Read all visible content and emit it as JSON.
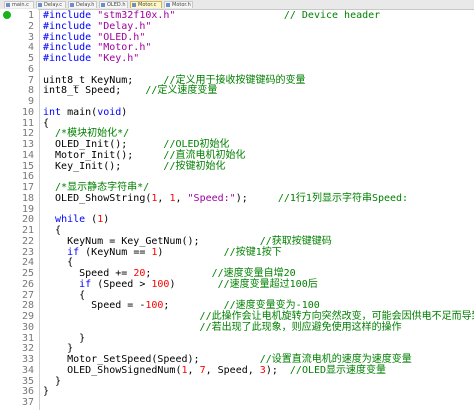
{
  "tabs": [
    {
      "label": "main.c",
      "active": false
    },
    {
      "label": "Delay.c",
      "active": false
    },
    {
      "label": "Delay.h",
      "active": false
    },
    {
      "label": "OLED.h",
      "active": false
    },
    {
      "label": "Motor.c",
      "active": true
    },
    {
      "label": "Motor.h",
      "active": false
    }
  ],
  "colors": {
    "keyword": "#0000ff",
    "string": "#a000a0",
    "number": "#ff0000",
    "comment": "#008000",
    "line_number": "#777777",
    "breakpoint": "#19b219"
  },
  "lines": [
    {
      "n": "1",
      "bp": true,
      "segs": [
        [
          "kw",
          "#include "
        ],
        [
          "str",
          "\"stm32f10x.h\""
        ],
        [
          "txt",
          "                  "
        ],
        [
          "cm",
          "// Device header"
        ]
      ]
    },
    {
      "n": "2",
      "segs": [
        [
          "kw",
          "#include "
        ],
        [
          "str",
          "\"Delay.h\""
        ]
      ]
    },
    {
      "n": "3",
      "segs": [
        [
          "kw",
          "#include "
        ],
        [
          "str",
          "\"OLED.h\""
        ]
      ]
    },
    {
      "n": "4",
      "segs": [
        [
          "kw",
          "#include "
        ],
        [
          "str",
          "\"Motor.h\""
        ]
      ]
    },
    {
      "n": "5",
      "segs": [
        [
          "kw",
          "#include "
        ],
        [
          "str",
          "\"Key.h\""
        ]
      ]
    },
    {
      "n": "6",
      "segs": []
    },
    {
      "n": "7",
      "segs": [
        [
          "txt",
          "uint8_t KeyNum;     "
        ],
        [
          "cm",
          "//定义用于接收按键键码的变量"
        ]
      ]
    },
    {
      "n": "8",
      "segs": [
        [
          "txt",
          "int8_t Speed;    "
        ],
        [
          "cm",
          "//定义速度变量"
        ]
      ]
    },
    {
      "n": "9",
      "segs": []
    },
    {
      "n": "10",
      "segs": [
        [
          "kw",
          "int "
        ],
        [
          "txt",
          "main("
        ],
        [
          "kw",
          "void"
        ],
        [
          "txt",
          ")"
        ]
      ]
    },
    {
      "n": "11",
      "segs": [
        [
          "txt",
          "{"
        ]
      ]
    },
    {
      "n": "12",
      "segs": [
        [
          "cm",
          "  /*模块初始化*/"
        ]
      ]
    },
    {
      "n": "13",
      "segs": [
        [
          "txt",
          "  OLED_Init();      "
        ],
        [
          "cm",
          "//OLED初始化"
        ]
      ]
    },
    {
      "n": "14",
      "segs": [
        [
          "txt",
          "  Motor_Init();     "
        ],
        [
          "cm",
          "//直流电机初始化"
        ]
      ]
    },
    {
      "n": "15",
      "segs": [
        [
          "txt",
          "  Key_Init();       "
        ],
        [
          "cm",
          "//按键初始化"
        ]
      ]
    },
    {
      "n": "16",
      "segs": []
    },
    {
      "n": "17",
      "segs": [
        [
          "cm",
          "  /*显示静态字符串*/"
        ]
      ]
    },
    {
      "n": "18",
      "segs": [
        [
          "txt",
          "  OLED_ShowString("
        ],
        [
          "num",
          "1"
        ],
        [
          "txt",
          ", "
        ],
        [
          "num",
          "1"
        ],
        [
          "txt",
          ", "
        ],
        [
          "str",
          "\"Speed:\""
        ],
        [
          "txt",
          ");     "
        ],
        [
          "cm",
          "//1行1列显示字符串Speed:"
        ]
      ]
    },
    {
      "n": "19",
      "segs": []
    },
    {
      "n": "20",
      "segs": [
        [
          "txt",
          "  "
        ],
        [
          "kw",
          "while"
        ],
        [
          "txt",
          " ("
        ],
        [
          "num",
          "1"
        ],
        [
          "txt",
          ")"
        ]
      ]
    },
    {
      "n": "21",
      "segs": [
        [
          "txt",
          "  {"
        ]
      ]
    },
    {
      "n": "22",
      "segs": [
        [
          "txt",
          "    KeyNum = Key_GetNum();          "
        ],
        [
          "cm",
          "//获取按键键码"
        ]
      ]
    },
    {
      "n": "23",
      "segs": [
        [
          "txt",
          "    "
        ],
        [
          "kw",
          "if"
        ],
        [
          "txt",
          " (KeyNum == "
        ],
        [
          "num",
          "1"
        ],
        [
          "txt",
          ")          "
        ],
        [
          "cm",
          "//按键1按下"
        ]
      ]
    },
    {
      "n": "24",
      "segs": [
        [
          "txt",
          "    {"
        ]
      ]
    },
    {
      "n": "25",
      "segs": [
        [
          "txt",
          "      Speed += "
        ],
        [
          "num",
          "20"
        ],
        [
          "txt",
          ";          "
        ],
        [
          "cm",
          "//速度变量自增20"
        ]
      ]
    },
    {
      "n": "26",
      "segs": [
        [
          "txt",
          "      "
        ],
        [
          "kw",
          "if"
        ],
        [
          "txt",
          " (Speed > "
        ],
        [
          "num",
          "100"
        ],
        [
          "txt",
          ")       "
        ],
        [
          "cm",
          "//速度变量超过100后"
        ]
      ]
    },
    {
      "n": "27",
      "segs": [
        [
          "txt",
          "      {"
        ]
      ]
    },
    {
      "n": "28",
      "segs": [
        [
          "txt",
          "        Speed = -"
        ],
        [
          "num",
          "100"
        ],
        [
          "txt",
          ";         "
        ],
        [
          "cm",
          "//速度变量变为-100"
        ]
      ]
    },
    {
      "n": "29",
      "segs": [
        [
          "txt",
          "                          "
        ],
        [
          "cm",
          "//此操作会让电机旋转方向突然改变，可能会因供电不足而导致单"
        ]
      ]
    },
    {
      "n": "30",
      "segs": [
        [
          "txt",
          "                          "
        ],
        [
          "cm",
          "//若出现了此现象，则应避免使用这样的操作"
        ]
      ]
    },
    {
      "n": "31",
      "segs": [
        [
          "txt",
          "      }"
        ]
      ]
    },
    {
      "n": "32",
      "segs": [
        [
          "txt",
          "    }"
        ]
      ]
    },
    {
      "n": "33",
      "segs": [
        [
          "txt",
          "    Motor_SetSpeed(Speed);          "
        ],
        [
          "cm",
          "//设置直流电机的速度为速度变量"
        ]
      ]
    },
    {
      "n": "34",
      "segs": [
        [
          "txt",
          "    OLED_ShowSignedNum("
        ],
        [
          "num",
          "1"
        ],
        [
          "txt",
          ", "
        ],
        [
          "num",
          "7"
        ],
        [
          "txt",
          ", Speed, "
        ],
        [
          "num",
          "3"
        ],
        [
          "txt",
          ");  "
        ],
        [
          "cm",
          "//OLED显示速度变量"
        ]
      ]
    },
    {
      "n": "35",
      "segs": [
        [
          "txt",
          "  }"
        ]
      ]
    },
    {
      "n": "36",
      "segs": [
        [
          "txt",
          "}"
        ]
      ]
    },
    {
      "n": "37",
      "segs": []
    }
  ]
}
